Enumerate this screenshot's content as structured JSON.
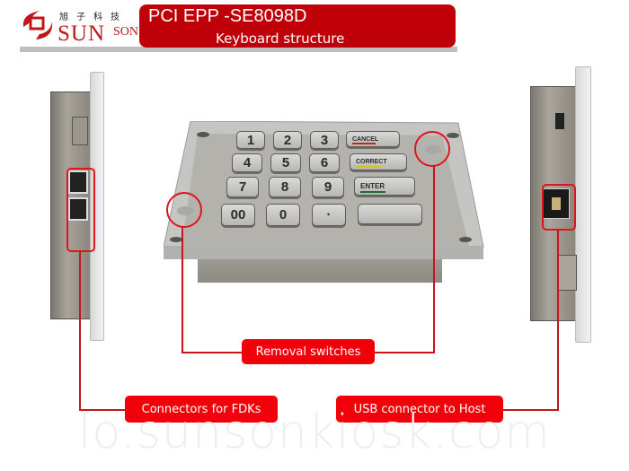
{
  "header": {
    "logo": {
      "chinese": "旭子科技",
      "brand_main": "SUN",
      "brand_suffix": "SON"
    },
    "title": "PCI EPP -SE8098D",
    "subtitle": "Keyboard structure"
  },
  "keypad": {
    "keys": [
      "1",
      "2",
      "3",
      "4",
      "5",
      "6",
      "7",
      "8",
      "9",
      "00",
      "0",
      "·"
    ],
    "function_keys": [
      {
        "label": "CANCEL",
        "bar_color": "#c8201e"
      },
      {
        "label": "CORRECT",
        "bar_color": "#d7c21a"
      },
      {
        "label": "ENTER",
        "bar_color": "#1e6b34"
      },
      {
        "label": ""
      }
    ]
  },
  "callouts": {
    "removal": "Removal switches",
    "fdk": "Connectors for FDKs",
    "usb": "USB connector to Host"
  },
  "colors": {
    "brand_red": "#c00008",
    "callout_red": "#f20009",
    "line_red": "#c4161c"
  },
  "watermark": "lo.sunsonkiosk.com"
}
